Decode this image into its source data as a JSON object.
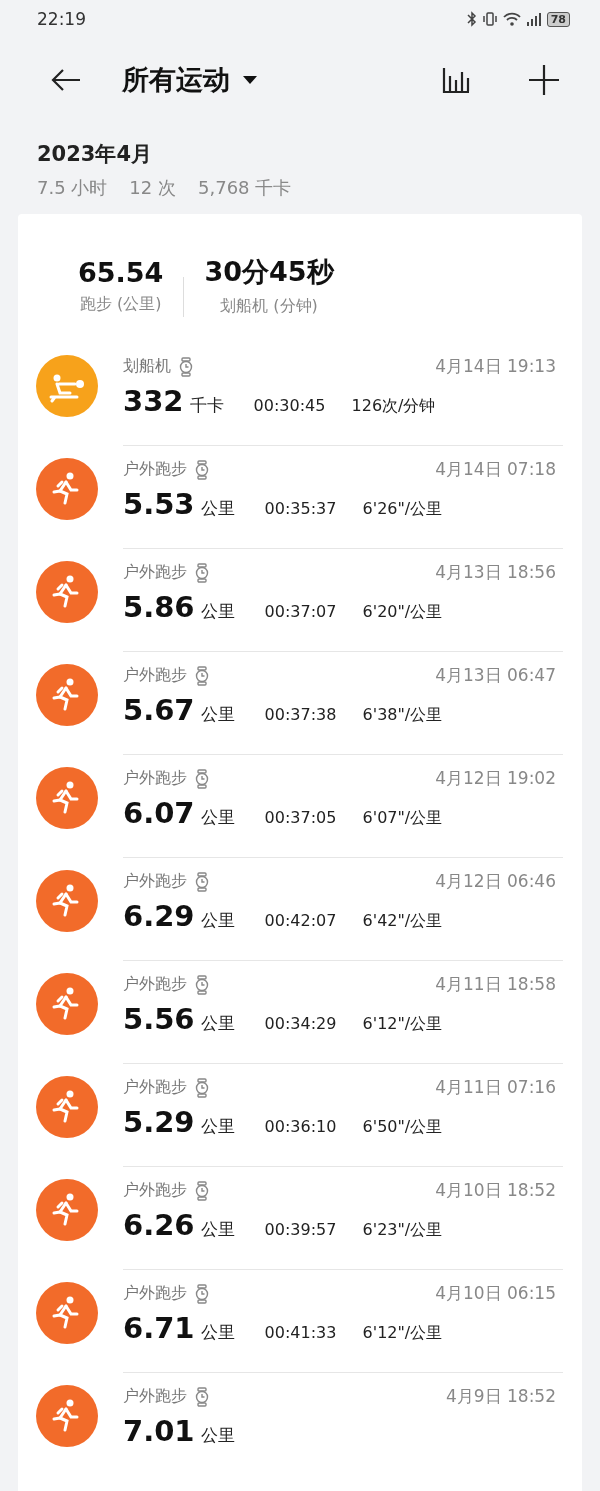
{
  "status_bar": {
    "time": "22:19",
    "battery": "78"
  },
  "header": {
    "title": "所有运动"
  },
  "month": {
    "title": "2023年4月",
    "stats": [
      "7.5 小时",
      "12 次",
      "5,768 千卡"
    ]
  },
  "summary": [
    {
      "value": "65.54",
      "label": "跑步 (公里)"
    },
    {
      "value": "30分45秒",
      "label": "划船机 (分钟)"
    }
  ],
  "workouts": [
    {
      "kind": "rowing",
      "name": "划船机",
      "date": "4月14日 19:13",
      "value": "332",
      "unit": "千卡",
      "duration": "00:30:45",
      "rate": "126次/分钟"
    },
    {
      "kind": "run",
      "name": "户外跑步",
      "date": "4月14日 07:18",
      "value": "5.53",
      "unit": "公里",
      "duration": "00:35:37",
      "rate": "6'26\"/公里"
    },
    {
      "kind": "run",
      "name": "户外跑步",
      "date": "4月13日 18:56",
      "value": "5.86",
      "unit": "公里",
      "duration": "00:37:07",
      "rate": "6'20\"/公里"
    },
    {
      "kind": "run",
      "name": "户外跑步",
      "date": "4月13日 06:47",
      "value": "5.67",
      "unit": "公里",
      "duration": "00:37:38",
      "rate": "6'38\"/公里"
    },
    {
      "kind": "run",
      "name": "户外跑步",
      "date": "4月12日 19:02",
      "value": "6.07",
      "unit": "公里",
      "duration": "00:37:05",
      "rate": "6'07\"/公里"
    },
    {
      "kind": "run",
      "name": "户外跑步",
      "date": "4月12日 06:46",
      "value": "6.29",
      "unit": "公里",
      "duration": "00:42:07",
      "rate": "6'42\"/公里"
    },
    {
      "kind": "run",
      "name": "户外跑步",
      "date": "4月11日 18:58",
      "value": "5.56",
      "unit": "公里",
      "duration": "00:34:29",
      "rate": "6'12\"/公里"
    },
    {
      "kind": "run",
      "name": "户外跑步",
      "date": "4月11日 07:16",
      "value": "5.29",
      "unit": "公里",
      "duration": "00:36:10",
      "rate": "6'50\"/公里"
    },
    {
      "kind": "run",
      "name": "户外跑步",
      "date": "4月10日 18:52",
      "value": "6.26",
      "unit": "公里",
      "duration": "00:39:57",
      "rate": "6'23\"/公里"
    },
    {
      "kind": "run",
      "name": "户外跑步",
      "date": "4月10日 06:15",
      "value": "6.71",
      "unit": "公里",
      "duration": "00:41:33",
      "rate": "6'12\"/公里"
    },
    {
      "kind": "run",
      "name": "户外跑步",
      "date": "4月9日 18:52",
      "value": "7.01",
      "unit": "公里"
    }
  ]
}
